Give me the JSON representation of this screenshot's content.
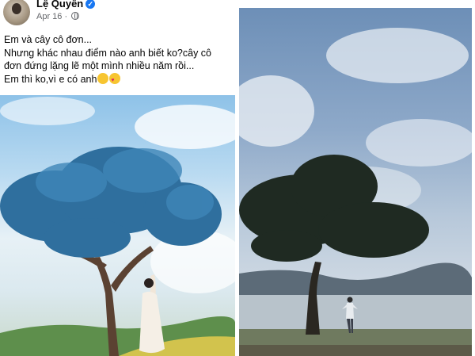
{
  "post": {
    "author": "Lệ Quyên",
    "date": "Apr 16",
    "audience_icon": "globe-icon",
    "verified_icon": "verified-badge-icon",
    "caption_lines": [
      "Em và cây cô đơn...",
      "Nhưng khác nhau điểm nào anh biết ko?cây cô",
      "đơn đứng lặng lẽ một mình nhiều năm rồi...",
      "Em thì ko,vì e có anh"
    ],
    "caption_emojis": [
      "grinning-emoji",
      "smiling-face-with-hearts-emoji"
    ]
  },
  "photos": [
    {
      "name": "woman-under-pine-tree-photo"
    },
    {
      "name": "man-under-tree-lake-photo"
    }
  ],
  "colors": {
    "text": "#050505",
    "meta": "#65676b",
    "verified": "#1877f2"
  }
}
